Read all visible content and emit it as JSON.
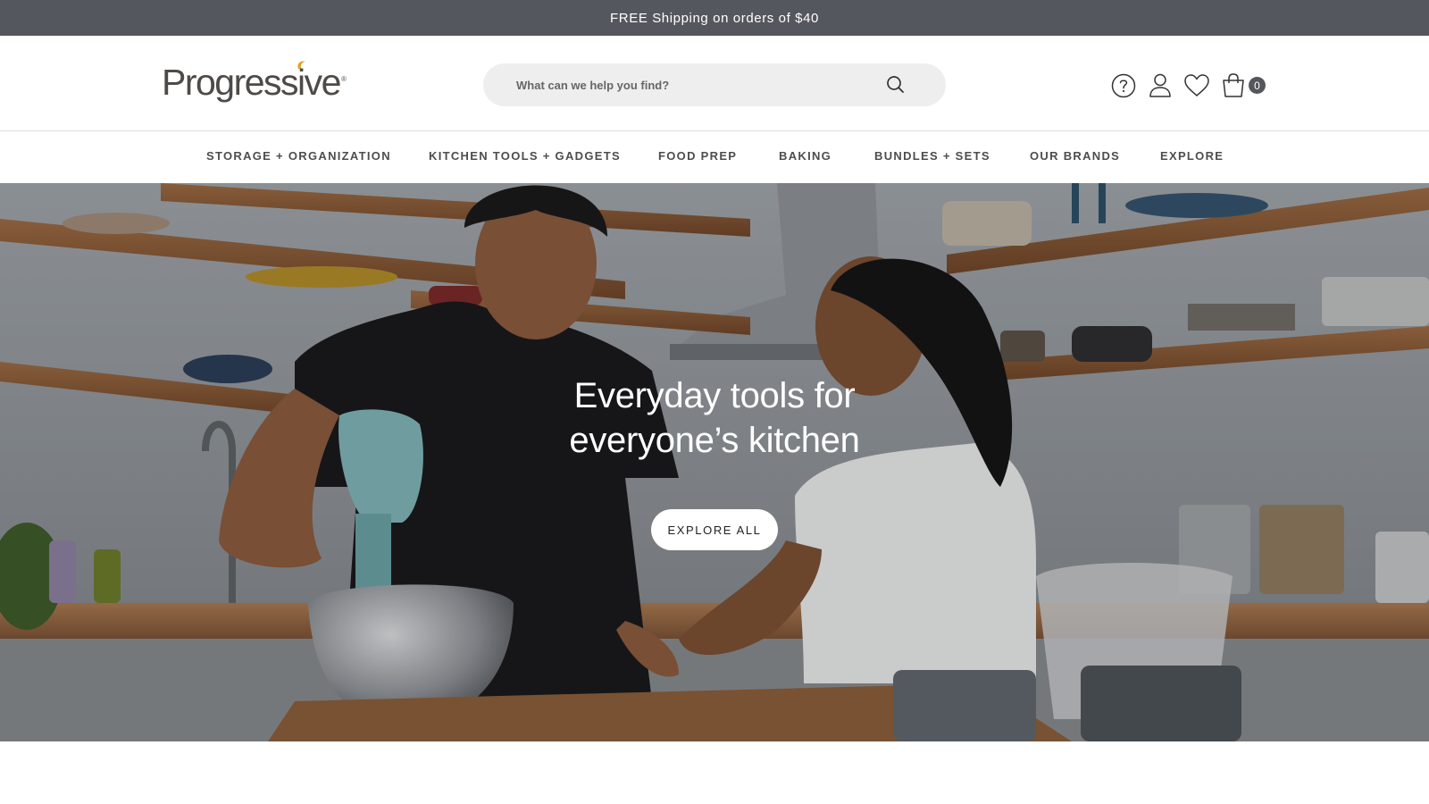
{
  "announcement": {
    "text": "FREE Shipping on orders of $40"
  },
  "header": {
    "logo_text": "Progressive",
    "logo_reg": "®",
    "search": {
      "placeholder": "What can we help you find?",
      "icon": "search-icon"
    },
    "utility_icons": [
      "help-icon",
      "account-icon",
      "wishlist-heart-icon",
      "cart-bag-icon"
    ],
    "cart_count": "0"
  },
  "nav": {
    "items": [
      {
        "label": "STORAGE + ORGANIZATION"
      },
      {
        "label": "KITCHEN TOOLS + GADGETS"
      },
      {
        "label": "FOOD PREP"
      },
      {
        "label": "BAKING"
      },
      {
        "label": "BUNDLES + SETS"
      },
      {
        "label": "OUR BRANDS"
      },
      {
        "label": "EXPLORE"
      }
    ]
  },
  "hero": {
    "title_line1": "Everyday tools for",
    "title_line2": "everyone’s kitchen",
    "cta_label": "EXPLORE ALL"
  },
  "colors": {
    "announcement_bg": "#55575e",
    "logo_accent": "#e2a325",
    "search_bg": "#eeeeee"
  }
}
